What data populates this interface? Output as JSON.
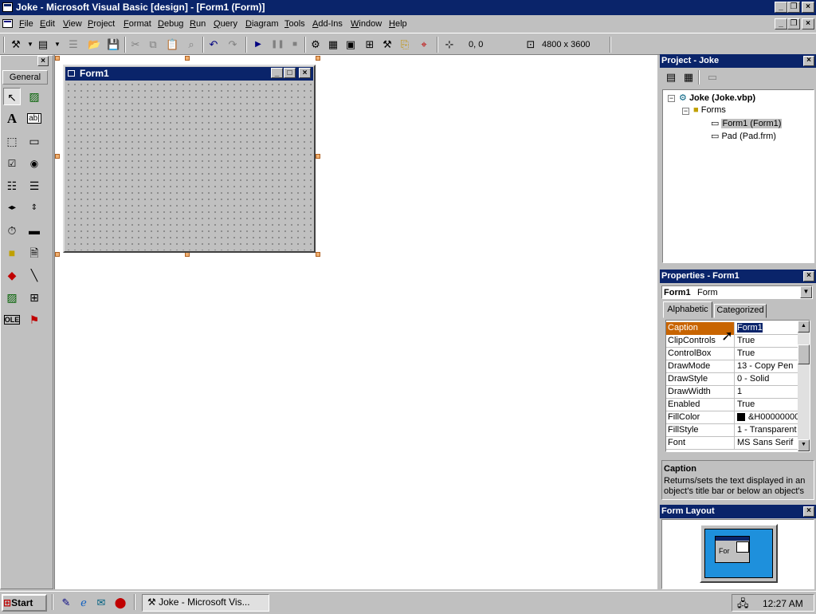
{
  "window": {
    "title": "Joke - Microsoft Visual Basic [design] - [Form1 (Form)]"
  },
  "menu": [
    "File",
    "Edit",
    "View",
    "Project",
    "Format",
    "Debug",
    "Run",
    "Query",
    "Diagram",
    "Tools",
    "Add-Ins",
    "Window",
    "Help"
  ],
  "toolbar": {
    "position": "0, 0",
    "size": "4800 x 3600"
  },
  "toolbox": {
    "tab": "General"
  },
  "form_designer": {
    "title": "Form1"
  },
  "project_panel": {
    "title": "Project - Joke",
    "tree": [
      "Joke (Joke.vbp)",
      "Forms",
      "Form1 (Form1)",
      "Pad (Pad.frm)"
    ]
  },
  "properties_panel": {
    "title": "Properties - Form1",
    "object_name": "Form1",
    "object_type": "Form",
    "tabs": [
      "Alphabetic",
      "Categorized"
    ],
    "rows": [
      {
        "name": "Caption",
        "value": "Form1"
      },
      {
        "name": "ClipControls",
        "value": "True"
      },
      {
        "name": "ControlBox",
        "value": "True"
      },
      {
        "name": "DrawMode",
        "value": "13 - Copy Pen"
      },
      {
        "name": "DrawStyle",
        "value": "0 - Solid"
      },
      {
        "name": "DrawWidth",
        "value": "1"
      },
      {
        "name": "Enabled",
        "value": "True"
      },
      {
        "name": "FillColor",
        "value": "&H00000000"
      },
      {
        "name": "FillStyle",
        "value": "1 - Transparent"
      },
      {
        "name": "Font",
        "value": "MS Sans Serif"
      }
    ],
    "desc_title": "Caption",
    "desc_text": "Returns/sets the text displayed in an object's title bar or below an object's"
  },
  "layout_panel": {
    "title": "Form Layout",
    "form_label": "For"
  },
  "taskbar": {
    "start": "Start",
    "task": "Joke - Microsoft Vis...",
    "clock": "12:27 AM"
  },
  "colors": {
    "titlebar": "#0a246a",
    "selected_property": "#c86400",
    "layout_screen": "#1e90dc"
  }
}
